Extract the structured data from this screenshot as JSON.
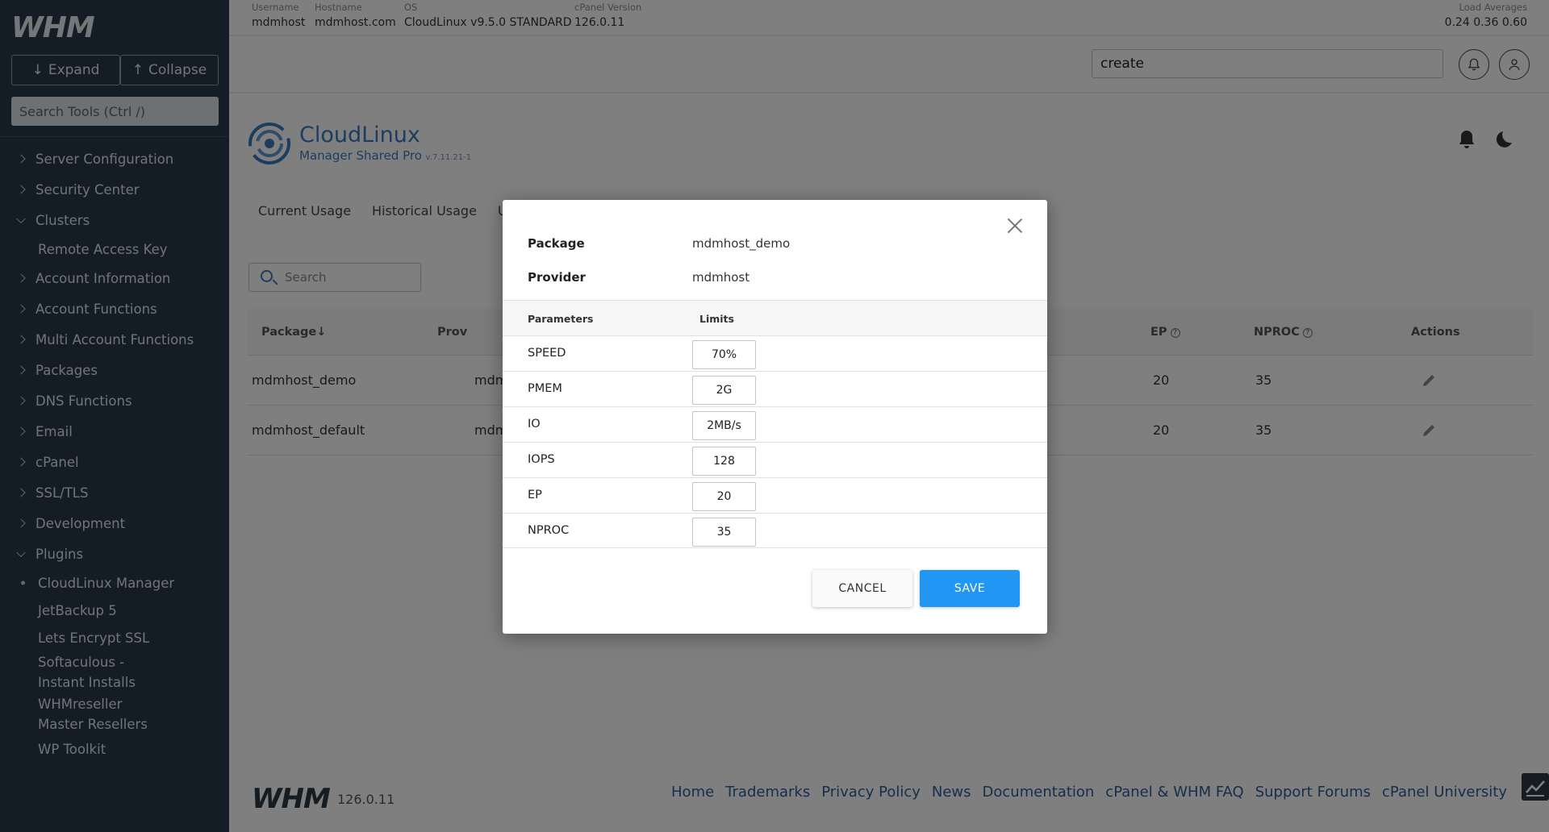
{
  "sidebar": {
    "logo": "WHM",
    "expand_label": "Expand",
    "collapse_label": "Collapse",
    "search_placeholder": "Search Tools (Ctrl /)",
    "items": [
      {
        "label": "Server Configuration",
        "type": "group"
      },
      {
        "label": "Security Center",
        "type": "group"
      },
      {
        "label": "Clusters",
        "type": "group-open"
      },
      {
        "label": "Remote Access Key",
        "type": "sub"
      },
      {
        "label": "Account Information",
        "type": "group"
      },
      {
        "label": "Account Functions",
        "type": "group"
      },
      {
        "label": "Multi Account Functions",
        "type": "group"
      },
      {
        "label": "Packages",
        "type": "group"
      },
      {
        "label": "DNS Functions",
        "type": "group"
      },
      {
        "label": "Email",
        "type": "group"
      },
      {
        "label": "cPanel",
        "type": "group"
      },
      {
        "label": "SSL/TLS",
        "type": "group"
      },
      {
        "label": "Development",
        "type": "group"
      },
      {
        "label": "Plugins",
        "type": "group-open"
      },
      {
        "label": "CloudLinux Manager",
        "type": "sub-active"
      },
      {
        "label": "JetBackup 5",
        "type": "sub"
      },
      {
        "label": "Lets Encrypt SSL",
        "type": "sub"
      },
      {
        "label": "Softaculous - Instant Installs",
        "type": "sub-multi"
      },
      {
        "label": "WHMreseller Master Resellers",
        "type": "sub-multi"
      },
      {
        "label": "WP Toolkit",
        "type": "sub"
      }
    ]
  },
  "topbar": {
    "username_label": "Username",
    "username": "mdmhost",
    "hostname_label": "Hostname",
    "hostname": "mdmhost.com",
    "os_label": "OS",
    "os": "CloudLinux v9.5.0 STANDARD",
    "cpanel_label": "cPanel Version",
    "cpanel": "126.0.11",
    "load_label": "Load Averages",
    "load": "0.24  0.36  0.60"
  },
  "header": {
    "search_value": "create"
  },
  "content": {
    "brand_title": "CloudLinux",
    "brand_sub": "Manager Shared Pro",
    "brand_version": "v.7.11.21-1",
    "tabs": [
      "Current Usage",
      "Historical Usage",
      "Us"
    ],
    "search_placeholder": "Search",
    "table": {
      "headers": {
        "package": "Package",
        "provider": "Prov",
        "ep": "EP",
        "nproc": "NPROC",
        "actions": "Actions"
      },
      "rows": [
        {
          "package": "mdmhost_demo",
          "provider": "mdm",
          "ep": "20",
          "nproc": "35"
        },
        {
          "package": "mdmhost_default",
          "provider": "mdm",
          "ep": "20",
          "nproc": "35"
        }
      ]
    }
  },
  "footer": {
    "logo": "WHM",
    "version": "126.0.11",
    "links": [
      "Home",
      "Trademarks",
      "Privacy Policy",
      "News",
      "Documentation",
      "cPanel & WHM FAQ",
      "Support Forums",
      "cPanel University"
    ]
  },
  "modal": {
    "package_label": "Package",
    "package_value": "mdmhost_demo",
    "provider_label": "Provider",
    "provider_value": "mdmhost",
    "params_header": "Parameters",
    "limits_header": "Limits",
    "params": [
      {
        "name": "SPEED",
        "value": "70%"
      },
      {
        "name": "PMEM",
        "value": "2G"
      },
      {
        "name": "IO",
        "value": "2MB/s"
      },
      {
        "name": "IOPS",
        "value": "128"
      },
      {
        "name": "EP",
        "value": "20"
      },
      {
        "name": "NPROC",
        "value": "35"
      }
    ],
    "cancel_label": "CANCEL",
    "save_label": "SAVE"
  },
  "colors": {
    "sidebar_bg": "#293a4a",
    "primary": "#2196f3",
    "brand": "#3a7bbf"
  }
}
